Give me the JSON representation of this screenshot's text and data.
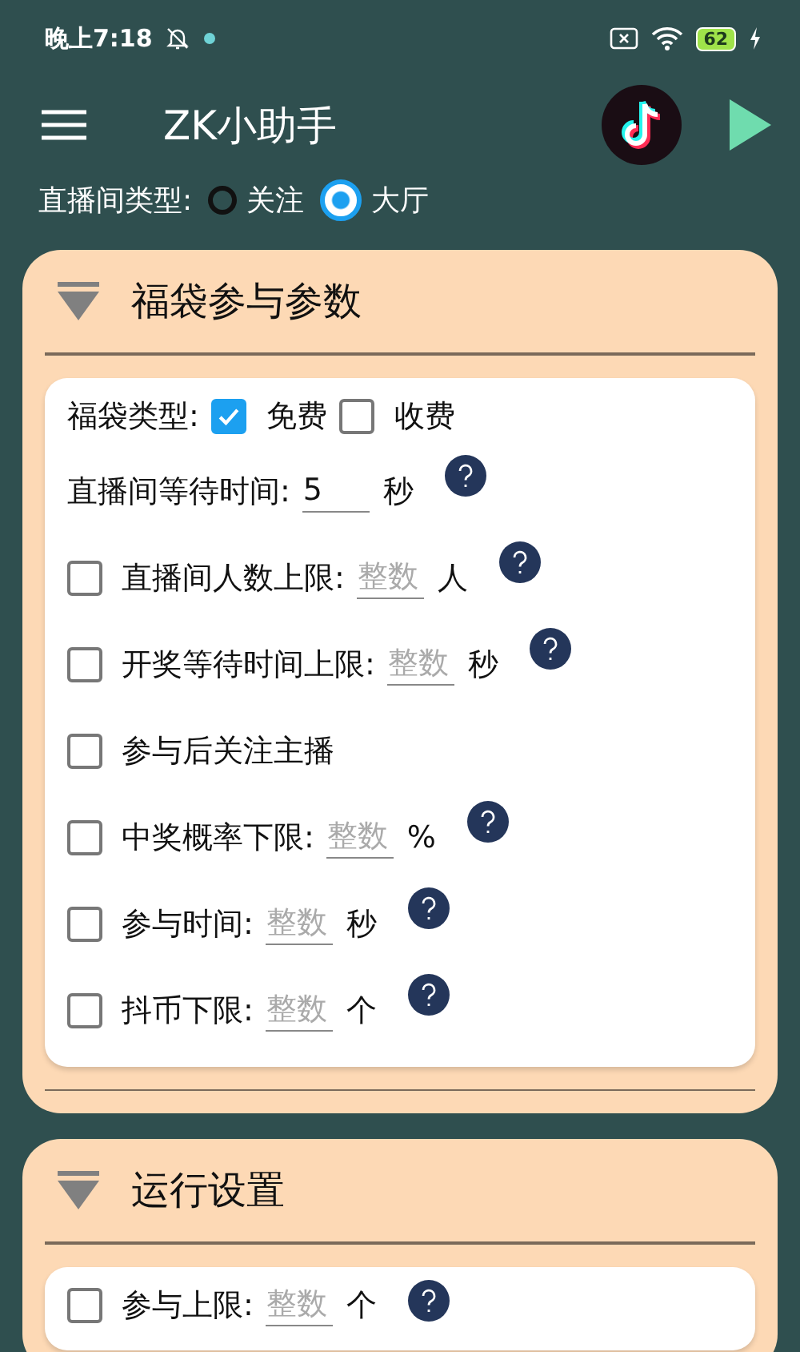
{
  "status_bar": {
    "time": "晚上7:18",
    "battery": "62"
  },
  "app_bar": {
    "title": "ZK小助手"
  },
  "room_type": {
    "label": "直播间类型:",
    "options": [
      {
        "label": "关注",
        "selected": false
      },
      {
        "label": "大厅",
        "selected": true
      }
    ]
  },
  "sections": [
    {
      "title": "福袋参与参数",
      "expanded": true,
      "rows": [
        {
          "kind": "checkgroup",
          "label": "福袋类型:",
          "options": [
            {
              "label": "免费",
              "checked": true
            },
            {
              "label": "收费",
              "checked": false
            }
          ]
        },
        {
          "kind": "input",
          "label": "直播间等待时间:",
          "value": "5",
          "unit": "秒"
        },
        {
          "kind": "check_input",
          "checked": false,
          "label": "直播间人数上限:",
          "placeholder": "整数",
          "unit": "人"
        },
        {
          "kind": "check_input",
          "checked": false,
          "label": "开奖等待时间上限:",
          "placeholder": "整数",
          "unit": "秒"
        },
        {
          "kind": "check",
          "checked": false,
          "label": "参与后关注主播"
        },
        {
          "kind": "check_input",
          "checked": false,
          "label": "中奖概率下限:",
          "placeholder": "整数",
          "unit": "%"
        },
        {
          "kind": "check_input",
          "checked": false,
          "label": "参与时间:",
          "placeholder": "整数",
          "unit": "秒"
        },
        {
          "kind": "check_input",
          "checked": false,
          "label": "抖币下限:",
          "placeholder": "整数",
          "unit": "个"
        }
      ]
    },
    {
      "title": "运行设置",
      "expanded": true,
      "rows": [
        {
          "kind": "check_input",
          "checked": false,
          "label": "参与上限:",
          "placeholder": "整数",
          "unit": "个"
        }
      ]
    }
  ]
}
